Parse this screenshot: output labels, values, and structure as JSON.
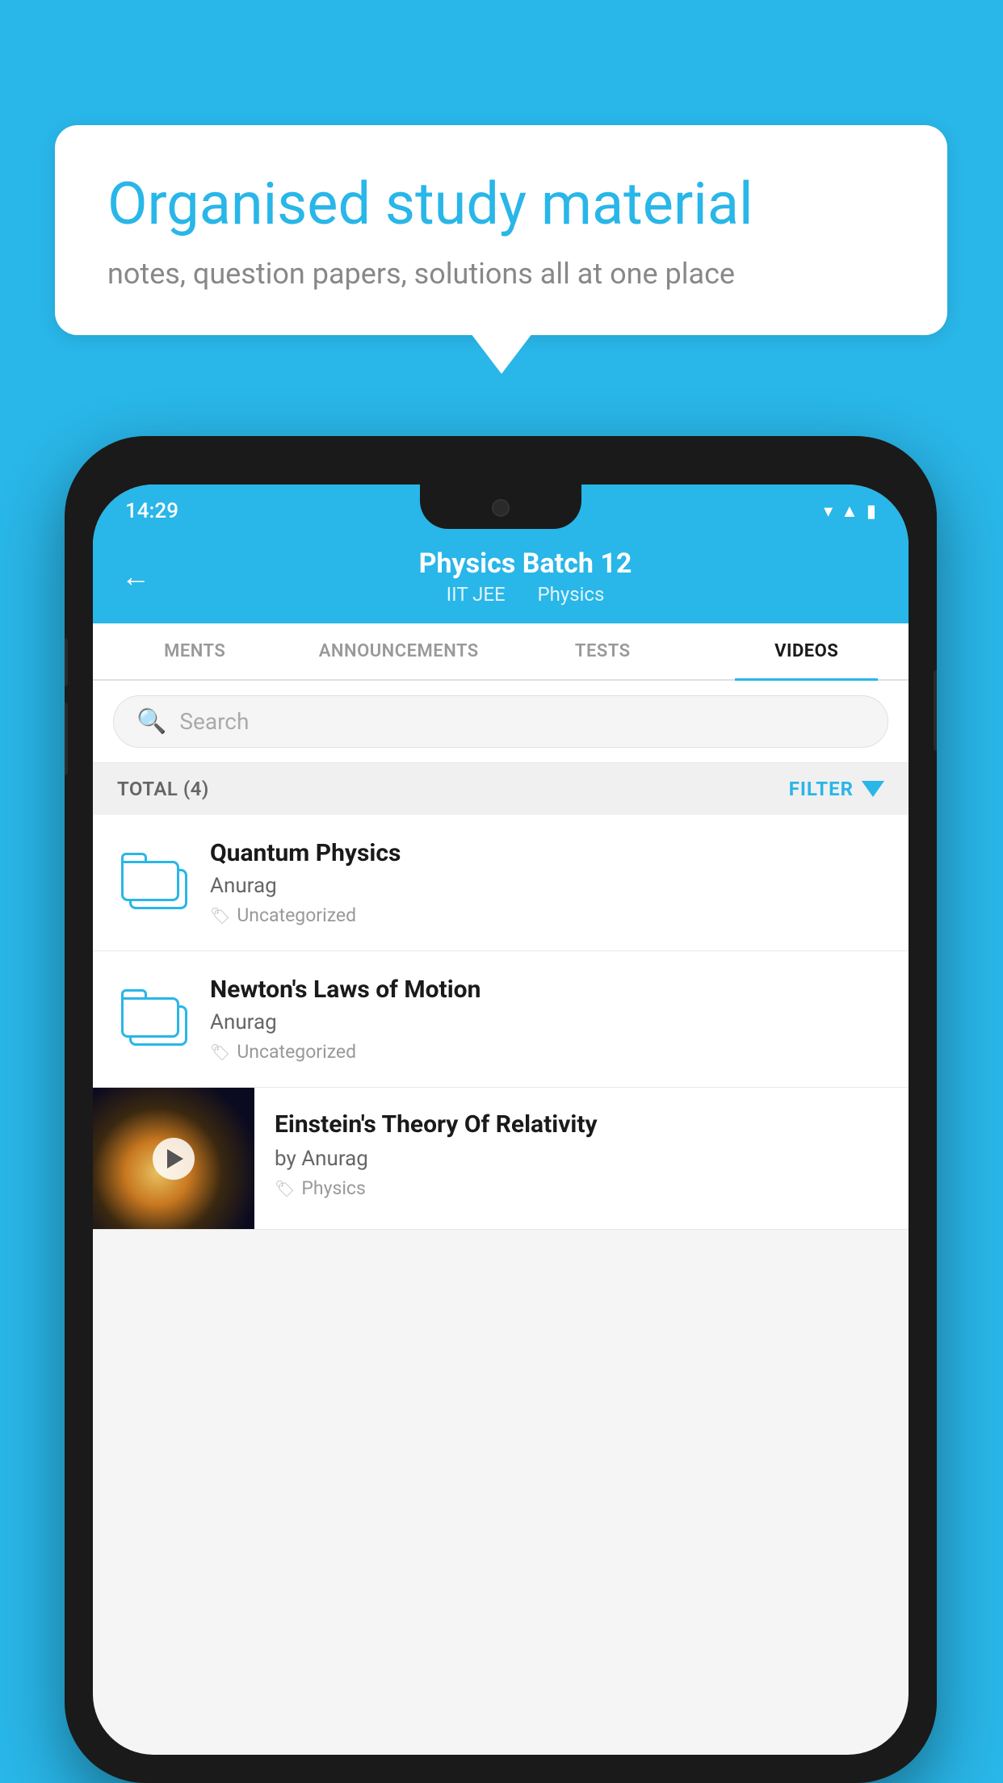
{
  "background_color": "#29b6e8",
  "bubble": {
    "title": "Organised study material",
    "subtitle": "notes, question papers, solutions all at one place"
  },
  "status_bar": {
    "time": "14:29",
    "icons": [
      "wifi",
      "signal",
      "battery"
    ]
  },
  "header": {
    "title": "Physics Batch 12",
    "subtitle1": "IIT JEE",
    "subtitle2": "Physics",
    "back_label": "←"
  },
  "tabs": [
    {
      "label": "MENTS",
      "active": false
    },
    {
      "label": "ANNOUNCEMENTS",
      "active": false
    },
    {
      "label": "TESTS",
      "active": false
    },
    {
      "label": "VIDEOS",
      "active": true
    }
  ],
  "search": {
    "placeholder": "Search"
  },
  "filter": {
    "total_label": "TOTAL (4)",
    "filter_label": "FILTER"
  },
  "videos": [
    {
      "id": 1,
      "title": "Quantum Physics",
      "author": "Anurag",
      "tag": "Uncategorized",
      "has_thumbnail": false
    },
    {
      "id": 2,
      "title": "Newton's Laws of Motion",
      "author": "Anurag",
      "tag": "Uncategorized",
      "has_thumbnail": false
    },
    {
      "id": 3,
      "title": "Einstein's Theory Of Relativity",
      "author": "by Anurag",
      "tag": "Physics",
      "has_thumbnail": true
    }
  ],
  "colors": {
    "accent": "#29b6e8",
    "text_dark": "#1a1a1a",
    "text_gray": "#666666",
    "text_light": "#999999"
  }
}
